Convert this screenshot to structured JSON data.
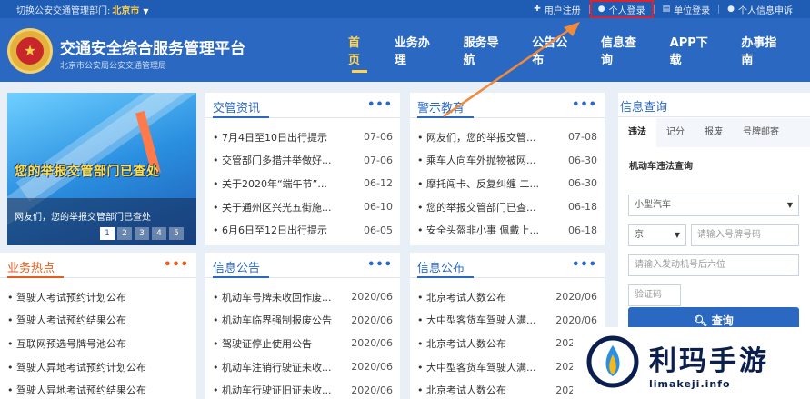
{
  "topbar": {
    "dept_label": "切换公安交通管理部门:",
    "dept_value": "北京市",
    "links": [
      {
        "icon": "plus-icon",
        "label": "用户注册"
      },
      {
        "icon": "user-icon",
        "label": "个人登录"
      },
      {
        "icon": "document-icon",
        "label": "单位登录"
      },
      {
        "icon": "user-icon",
        "label": "个人信息申诉"
      }
    ]
  },
  "header": {
    "title": "交通安全综合服务管理平台",
    "subtitle": "北京市公安局公安交通管理局",
    "nav": [
      "首页",
      "业务办理",
      "服务导航",
      "公告公布",
      "信息查询",
      "APP下载",
      "办事指南"
    ],
    "active_nav": "首页"
  },
  "banner": {
    "headline": "您的举报交管部门已查处",
    "headline2": "您的举报交管部门已查处",
    "caption": "网友们，您的举报交管部门已查处",
    "pages": [
      "1",
      "2",
      "3",
      "4",
      "5"
    ],
    "active_page": "1"
  },
  "panels": {
    "news": {
      "title": "交管资讯",
      "more": "•••",
      "items": [
        {
          "title": "• 7月4日至10日出行提示",
          "date": "07-06"
        },
        {
          "title": "• 交管部门多措并举做好...",
          "date": "07-06"
        },
        {
          "title": "• 关于2020年“端午节”...",
          "date": "06-12"
        },
        {
          "title": "• 关于通州区兴光五街施...",
          "date": "06-10"
        },
        {
          "title": "• 6月6日至12日出行提示",
          "date": "06-05"
        }
      ]
    },
    "warning": {
      "title": "警示教育",
      "more": "•••",
      "items": [
        {
          "title": "• 网友们，您的举报交管...",
          "date": "07-08"
        },
        {
          "title": "• 乘车人向车外抛物被网...",
          "date": "06-30"
        },
        {
          "title": "• 摩托闯卡、反复纠缠 二...",
          "date": "06-30"
        },
        {
          "title": "• 您的举报交管部门已查...",
          "date": "06-18"
        },
        {
          "title": "• 安全头盔非小事 佩戴上...",
          "date": "06-18"
        }
      ]
    },
    "hot": {
      "title": "业务热点",
      "more": "•••",
      "items": [
        {
          "title": "• 驾驶人考试预约计划公布",
          "date": ""
        },
        {
          "title": "• 驾驶人考试预约结果公布",
          "date": ""
        },
        {
          "title": "• 互联网预选号牌号池公布",
          "date": ""
        },
        {
          "title": "• 驾驶人异地考试预约计划公布",
          "date": ""
        },
        {
          "title": "• 驾驶人异地考试预约结果公布",
          "date": ""
        }
      ]
    },
    "notice": {
      "title": "信息公告",
      "more": "•••",
      "items": [
        {
          "title": "• 机动车号牌未收回作废...",
          "date": "2020/06"
        },
        {
          "title": "• 机动车临界强制报废公告",
          "date": "2020/06"
        },
        {
          "title": "• 驾驶证停止使用公告",
          "date": "2020/06"
        },
        {
          "title": "• 机动车注销行驶证未收...",
          "date": "2020/06"
        },
        {
          "title": "• 机动车行驶证旧证未收...",
          "date": "2020/06"
        }
      ]
    },
    "publish": {
      "title": "信息公布",
      "more": "•••",
      "items": [
        {
          "title": "• 北京考试人数公布",
          "date": "2020/06"
        },
        {
          "title": "• 大中型客货车驾驶人满...",
          "date": "2020/06"
        },
        {
          "title": "• 北京考试人数公布",
          "date": "2020/06"
        },
        {
          "title": "• 大中型客货车驾驶人满...",
          "date": "2020/06"
        },
        {
          "title": "• 北京考试人数公布",
          "date": "2020/06"
        }
      ]
    }
  },
  "query": {
    "title": "信息查询",
    "tabs": [
      "违法",
      "记分",
      "报废",
      "号牌邮寄"
    ],
    "active_tab": "违法",
    "heading": "机动车违法查询",
    "vehicle_type": "小型汽车",
    "province": "京",
    "plate_placeholder": "请输入号牌号码",
    "engine_placeholder": "请输入发动机号后六位",
    "captcha_placeholder": "验证码",
    "submit_label": "查询"
  },
  "watermark": {
    "name": "利玛手游",
    "url": "limakeji.info"
  },
  "colors": {
    "brand_blue": "#2a68c2",
    "top_bar": "#1f5cb4",
    "accent_yellow": "#ffd24a",
    "accent_orange": "#e85c1c",
    "annotation_red": "#e0202a",
    "annotation_arrow": "#f08a3c"
  }
}
